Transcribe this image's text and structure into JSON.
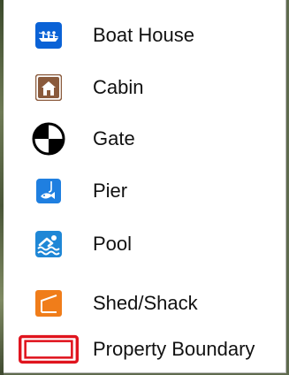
{
  "legend": {
    "items": [
      {
        "label": "Boat House",
        "icon": "boat-house-icon",
        "color": "#0a62d6"
      },
      {
        "label": "Cabin",
        "icon": "cabin-icon",
        "color": "#8a5a3c"
      },
      {
        "label": "Gate",
        "icon": "gate-icon",
        "color": "#000000"
      },
      {
        "label": "Pier",
        "icon": "pier-icon",
        "color": "#1f7fe0"
      },
      {
        "label": "Pool",
        "icon": "pool-icon",
        "color": "#1f87d6"
      },
      {
        "label": "Shed/Shack",
        "icon": "shed-icon",
        "color": "#f07d1a"
      },
      {
        "label": "Property Boundary",
        "icon": "property-boundary-icon",
        "color": "#e0141e"
      }
    ]
  }
}
